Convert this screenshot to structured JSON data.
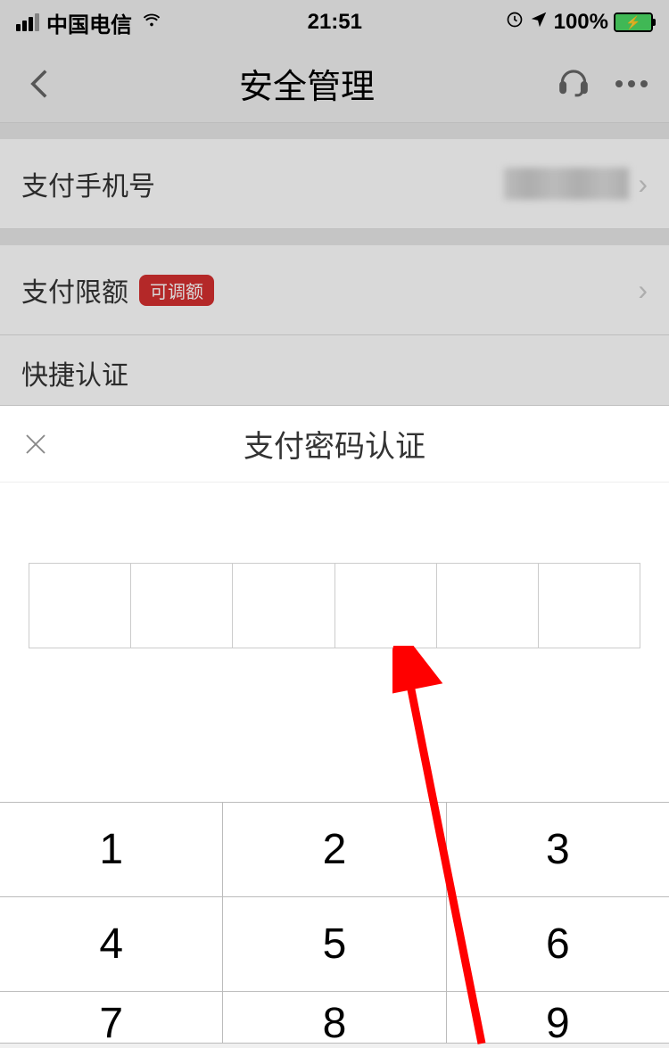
{
  "status_bar": {
    "carrier": "中国电信",
    "time": "21:51",
    "battery_percent": "100%"
  },
  "nav": {
    "title": "安全管理"
  },
  "items": {
    "phone": {
      "label": "支付手机号"
    },
    "limit": {
      "label": "支付限额",
      "badge": "可调额"
    },
    "quick_auth_header": "快捷认证"
  },
  "modal": {
    "title": "支付密码认证"
  },
  "keypad": {
    "keys": [
      "1",
      "2",
      "3",
      "4",
      "5",
      "6",
      "7",
      "8",
      "9"
    ]
  }
}
